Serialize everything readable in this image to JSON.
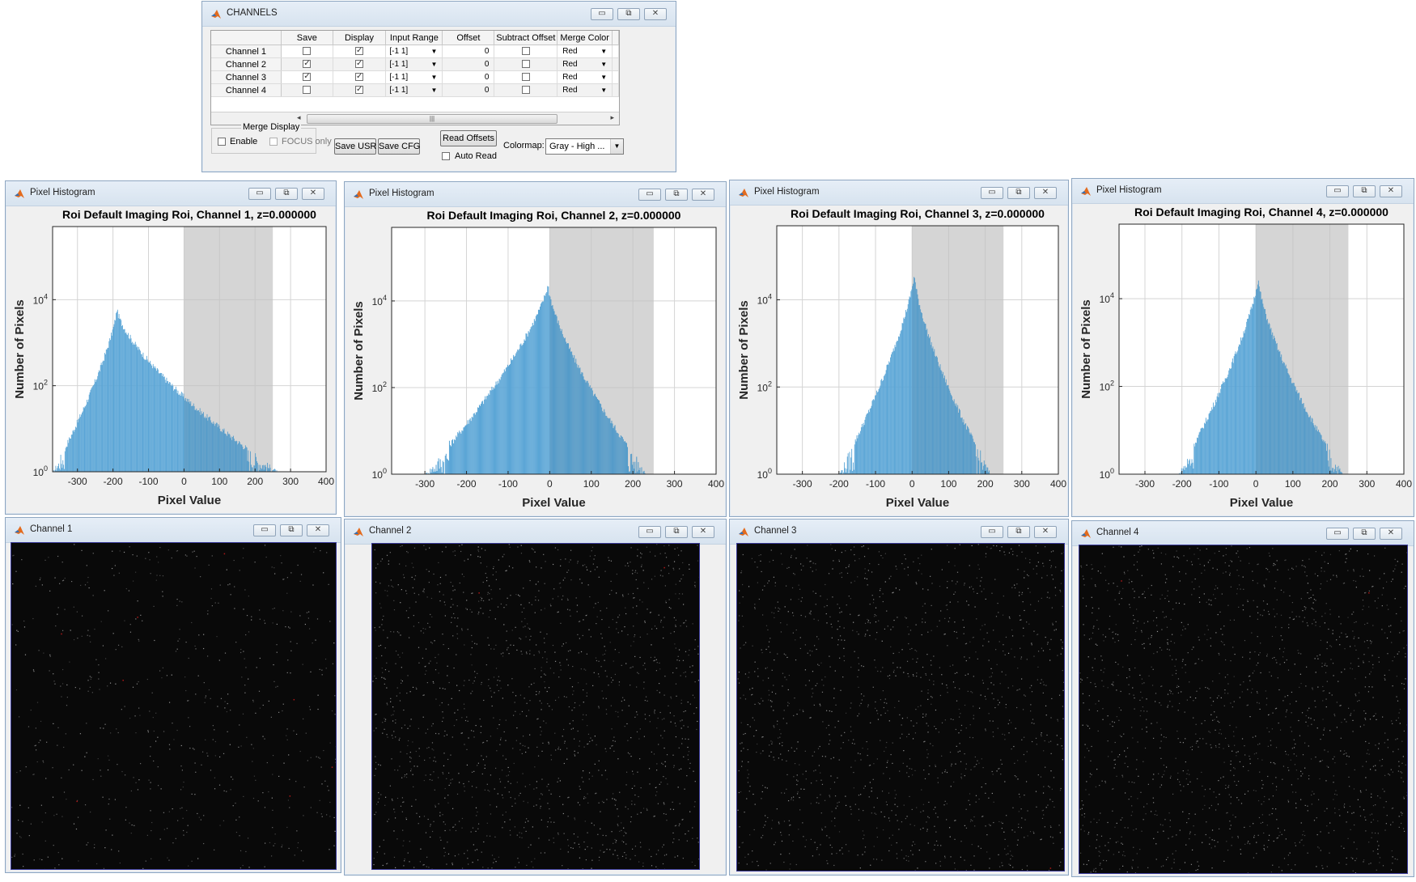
{
  "channels_window": {
    "title": "CHANNELS",
    "columns": [
      "",
      "Save",
      "Display",
      "Input Range",
      "Offset",
      "Subtract Offset",
      "Merge Color"
    ],
    "rows": [
      {
        "name": "Channel 1",
        "save": false,
        "display": true,
        "input_range": "[-1 1]",
        "offset": "0",
        "subtract_offset": false,
        "merge_color": "Red"
      },
      {
        "name": "Channel 2",
        "save": true,
        "display": true,
        "input_range": "[-1 1]",
        "offset": "0",
        "subtract_offset": false,
        "merge_color": "Red"
      },
      {
        "name": "Channel 3",
        "save": true,
        "display": true,
        "input_range": "[-1 1]",
        "offset": "0",
        "subtract_offset": false,
        "merge_color": "Red"
      },
      {
        "name": "Channel 4",
        "save": false,
        "display": true,
        "input_range": "[-1 1]",
        "offset": "0",
        "subtract_offset": false,
        "merge_color": "Red"
      }
    ],
    "merge_display": {
      "title": "Merge Display",
      "enable_label": "Enable",
      "enable": false,
      "focus_label": "FOCUS only",
      "focus": false
    },
    "buttons": {
      "save_usr": "Save USR",
      "save_cfg": "Save CFG",
      "read_offsets": "Read Offsets"
    },
    "auto_read": {
      "label": "Auto Read",
      "checked": false
    },
    "colormap": {
      "label": "Colormap:",
      "value": "Gray - High ..."
    }
  },
  "histograms": [
    {
      "window_title": "Pixel Histogram",
      "plot_title": "Roi Default Imaging Roi, Channel 1, z=0.000000"
    },
    {
      "window_title": "Pixel Histogram",
      "plot_title": "Roi Default Imaging Roi, Channel 2, z=0.000000"
    },
    {
      "window_title": "Pixel Histogram",
      "plot_title": "Roi Default Imaging Roi, Channel 3, z=0.000000"
    },
    {
      "window_title": "Pixel Histogram",
      "plot_title": "Roi Default Imaging Roi, Channel 4, z=0.000000"
    }
  ],
  "axis_labels": {
    "xlabel": "Pixel Value",
    "ylabel": "Number of Pixels"
  },
  "image_windows": [
    {
      "title": "Channel 1"
    },
    {
      "title": "Channel 2"
    },
    {
      "title": "Channel 3"
    },
    {
      "title": "Channel 4"
    }
  ],
  "window_buttons": {
    "minimize": "▭",
    "maximize": "⧉",
    "close": "✕"
  },
  "colors": {
    "bar": "#5aa5d6",
    "bar_edge": "#3f8fc4",
    "range_shade": "#e3e3e3"
  },
  "chart_data": [
    {
      "type": "bar",
      "title": "Roi Default Imaging Roi, Channel 1, z=0.000000",
      "xlabel": "Pixel Value",
      "ylabel": "Number of Pixels",
      "xlim": [
        -370,
        400
      ],
      "yscale": "log",
      "ylim": [
        1,
        500000
      ],
      "xticks": [
        -300,
        -200,
        -100,
        0,
        100,
        200,
        300,
        400
      ],
      "yticks": [
        "10^0",
        "10^2",
        "10^4"
      ],
      "grid": true,
      "shaded_range": [
        0,
        250
      ],
      "peak_x": -190,
      "peak_y": 6000,
      "left_tail_min_x": -370,
      "right_tail_max_x": 265
    },
    {
      "type": "bar",
      "title": "Roi Default Imaging Roi, Channel 2, z=0.000000",
      "xlabel": "Pixel Value",
      "ylabel": "Number of Pixels",
      "xlim": [
        -380,
        400
      ],
      "yscale": "log",
      "ylim": [
        1,
        500000
      ],
      "xticks": [
        -300,
        -200,
        -100,
        0,
        100,
        200,
        300,
        400
      ],
      "yticks": [
        "10^0",
        "10^2",
        "10^4"
      ],
      "grid": true,
      "shaded_range": [
        0,
        250
      ],
      "peak_x": -5,
      "peak_y": 25000,
      "left_tail_min_x": -300,
      "right_tail_max_x": 235
    },
    {
      "type": "bar",
      "title": "Roi Default Imaging Roi, Channel 3, z=0.000000",
      "xlabel": "Pixel Value",
      "ylabel": "Number of Pixels",
      "xlim": [
        -370,
        400
      ],
      "yscale": "log",
      "ylim": [
        1,
        500000
      ],
      "xticks": [
        -300,
        -200,
        -100,
        0,
        100,
        200,
        300,
        400
      ],
      "yticks": [
        "10^0",
        "10^2",
        "10^4"
      ],
      "grid": true,
      "shaded_range": [
        0,
        250
      ],
      "peak_x": 5,
      "peak_y": 40000,
      "left_tail_min_x": -200,
      "right_tail_max_x": 215
    },
    {
      "type": "bar",
      "title": "Roi Default Imaging Roi, Channel 4, z=0.000000",
      "xlabel": "Pixel Value",
      "ylabel": "Number of Pixels",
      "xlim": [
        -370,
        400
      ],
      "yscale": "log",
      "ylim": [
        1,
        500000
      ],
      "xticks": [
        -300,
        -200,
        -100,
        0,
        100,
        200,
        300,
        400
      ],
      "yticks": [
        "10^0",
        "10^2",
        "10^4"
      ],
      "grid": true,
      "shaded_range": [
        0,
        250
      ],
      "peak_x": 5,
      "peak_y": 30000,
      "left_tail_min_x": -210,
      "right_tail_max_x": 235
    }
  ]
}
